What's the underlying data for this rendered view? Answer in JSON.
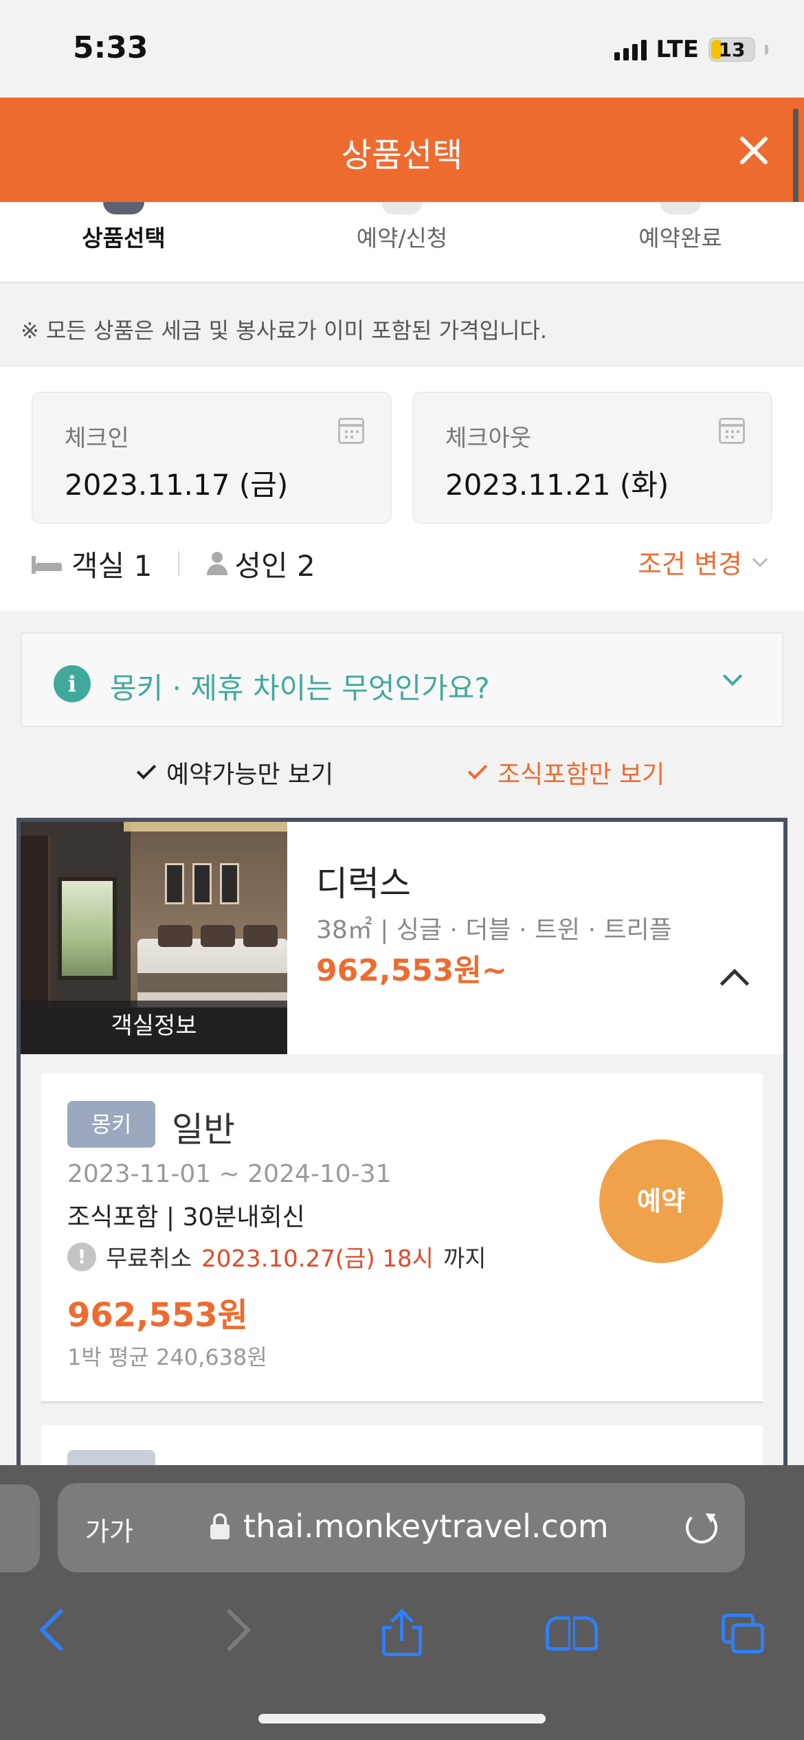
{
  "status_bar": {
    "time": "5:33",
    "network": "LTE",
    "battery": "13"
  },
  "header": {
    "title": "상품선택"
  },
  "steps": [
    {
      "label": "상품선택",
      "active": true
    },
    {
      "label": "예약/신청",
      "active": false
    },
    {
      "label": "예약완료",
      "active": false
    }
  ],
  "notice": "※ 모든 상품은 세금 및 봉사료가 이미 포함된 가격입니다.",
  "checkin": {
    "label": "체크인",
    "value": "2023.11.17 (금)"
  },
  "checkout": {
    "label": "체크아웃",
    "value": "2023.11.21 (화)"
  },
  "guests": {
    "rooms": "객실 1",
    "adults": "성인 2"
  },
  "condition_change": "조건 변경",
  "faq": {
    "icon": "i",
    "question": "몽키 · 제휴 차이는 무엇인가요?"
  },
  "filters": {
    "available_only": "예약가능만 보기",
    "breakfast_only": "조식포함만 보기"
  },
  "room": {
    "photo_caption": "객실정보",
    "name": "디럭스",
    "info": "38㎡ | 싱글 · 더블 · 트윈 · 트리플",
    "price": "962,553원~"
  },
  "plan": {
    "badge": "몽키",
    "name": "일반",
    "period": "2023-11-01 ~ 2024-10-31",
    "desc": "조식포함 | 30분내회신",
    "warn_icon": "!",
    "cancel_prefix": "무료취소",
    "cancel_date": "2023.10.27(금) 18시",
    "cancel_suffix": "까지",
    "price": "962,553원",
    "avg": "1박 평균 240,638원",
    "reserve": "예약"
  },
  "browser": {
    "text_size": "가가",
    "url": "thai.monkeytravel.com"
  },
  "colors": {
    "accent": "#ee6b2f",
    "teal": "#3fa99c",
    "reserve": "#f0a24a",
    "badge": "#9ba8be"
  }
}
